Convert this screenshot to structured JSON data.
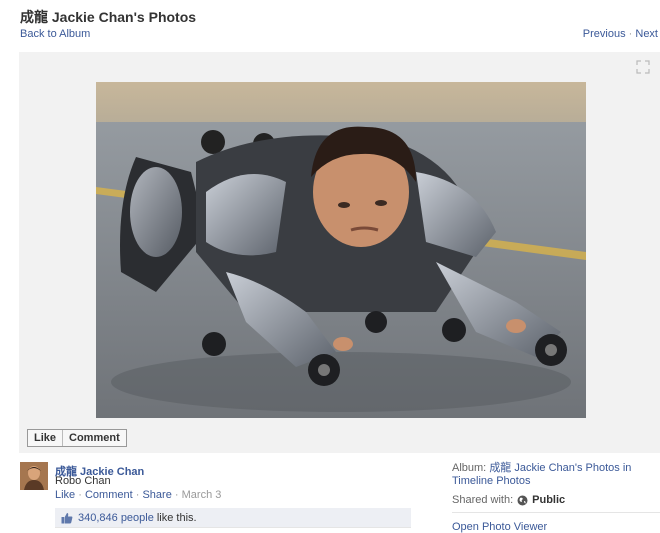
{
  "header": {
    "title": "成龍 Jackie Chan's Photos",
    "back_label": "Back to Album",
    "previous_label": "Previous",
    "separator": "·",
    "next_label": "Next"
  },
  "actions": {
    "like_label": "Like",
    "comment_label": "Comment"
  },
  "post": {
    "owner_name": "成龍 Jackie Chan",
    "caption": "Robo Chan",
    "like_link": "Like",
    "comment_link": "Comment",
    "share_link": "Share",
    "dot": "·",
    "date": "March 3",
    "likes_count": "340,846 people",
    "likes_suffix": "like this."
  },
  "sidebar": {
    "album_prefix": "Album:",
    "album_name": "成龍 Jackie Chan's Photos in Timeline Photos",
    "shared_prefix": "Shared with:",
    "privacy": "Public",
    "open_viewer_label": "Open Photo Viewer"
  },
  "icons": {
    "expand": "expand-icon",
    "thumbs_up": "thumbs-up-icon",
    "globe": "globe-icon"
  },
  "colors": {
    "link": "#3b5998",
    "stage_bg": "#f2f2f2",
    "likes_bg": "#edeff4"
  }
}
